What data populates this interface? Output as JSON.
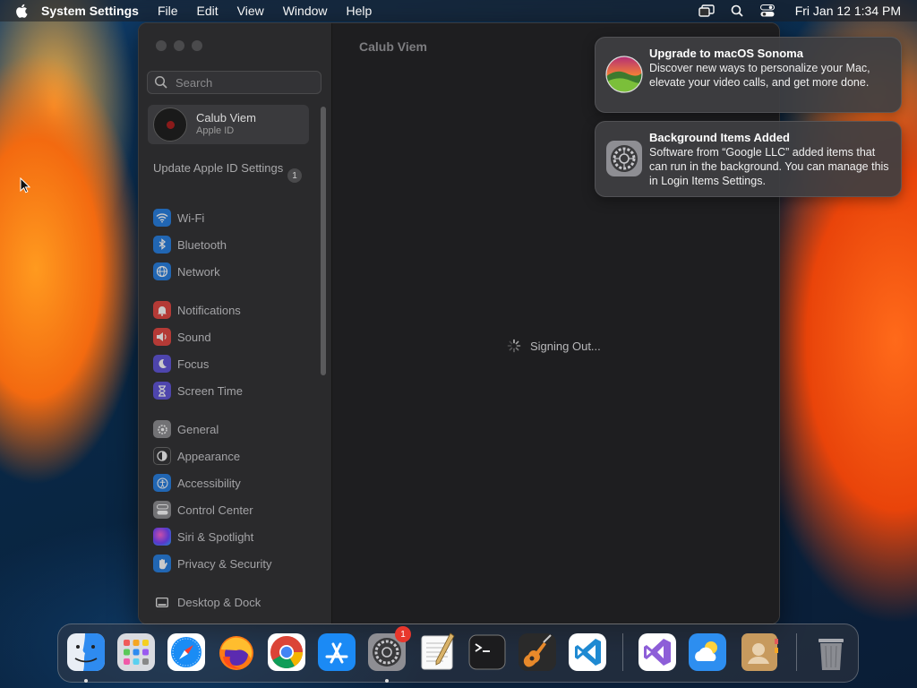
{
  "menubar": {
    "app_name": "System Settings",
    "items": [
      "File",
      "Edit",
      "View",
      "Window",
      "Help"
    ],
    "clock": "Fri Jan 12  1:34 PM"
  },
  "window": {
    "main_title": "Calub Viem",
    "status_text": "Signing Out...",
    "search": {
      "placeholder": "Search"
    },
    "account": {
      "name": "Calub Viem",
      "subtitle": "Apple ID"
    },
    "update_row": {
      "label": "Update Apple ID Settings",
      "badge": "1"
    },
    "sidebar_items": [
      {
        "label": "Wi-Fi",
        "icon": "wifi-icon"
      },
      {
        "label": "Bluetooth",
        "icon": "bluetooth-icon"
      },
      {
        "label": "Network",
        "icon": "network-globe-icon"
      },
      {
        "label": "Notifications",
        "icon": "bell-icon"
      },
      {
        "label": "Sound",
        "icon": "speaker-icon"
      },
      {
        "label": "Focus",
        "icon": "moon-icon"
      },
      {
        "label": "Screen Time",
        "icon": "hourglass-icon"
      },
      {
        "label": "General",
        "icon": "gear-icon"
      },
      {
        "label": "Appearance",
        "icon": "appearance-icon"
      },
      {
        "label": "Accessibility",
        "icon": "accessibility-icon"
      },
      {
        "label": "Control Center",
        "icon": "control-center-icon"
      },
      {
        "label": "Siri & Spotlight",
        "icon": "siri-icon"
      },
      {
        "label": "Privacy & Security",
        "icon": "hand-icon"
      },
      {
        "label": "Desktop & Dock",
        "icon": "desktop-icon"
      }
    ]
  },
  "notifications": [
    {
      "title": "Upgrade to macOS Sonoma",
      "body": "Discover new ways to personalize your Mac, elevate your video calls, and get more done.",
      "icon": "macos-sonoma-icon"
    },
    {
      "title": "Background Items Added",
      "body": "Software from “Google LLC” added items that can run in the background. You can manage this in Login Items Settings.",
      "icon": "system-settings-gear-icon"
    }
  ],
  "dock": {
    "apps": [
      "Finder",
      "Launchpad",
      "Safari",
      "Firefox",
      "Chrome",
      "App Store",
      "System Settings",
      "TextEdit",
      "Terminal",
      "GarageBand",
      "Visual Studio Code",
      "Visual Studio",
      "Weather",
      "Contacts",
      "Trash"
    ],
    "system_settings_badge": "1"
  }
}
